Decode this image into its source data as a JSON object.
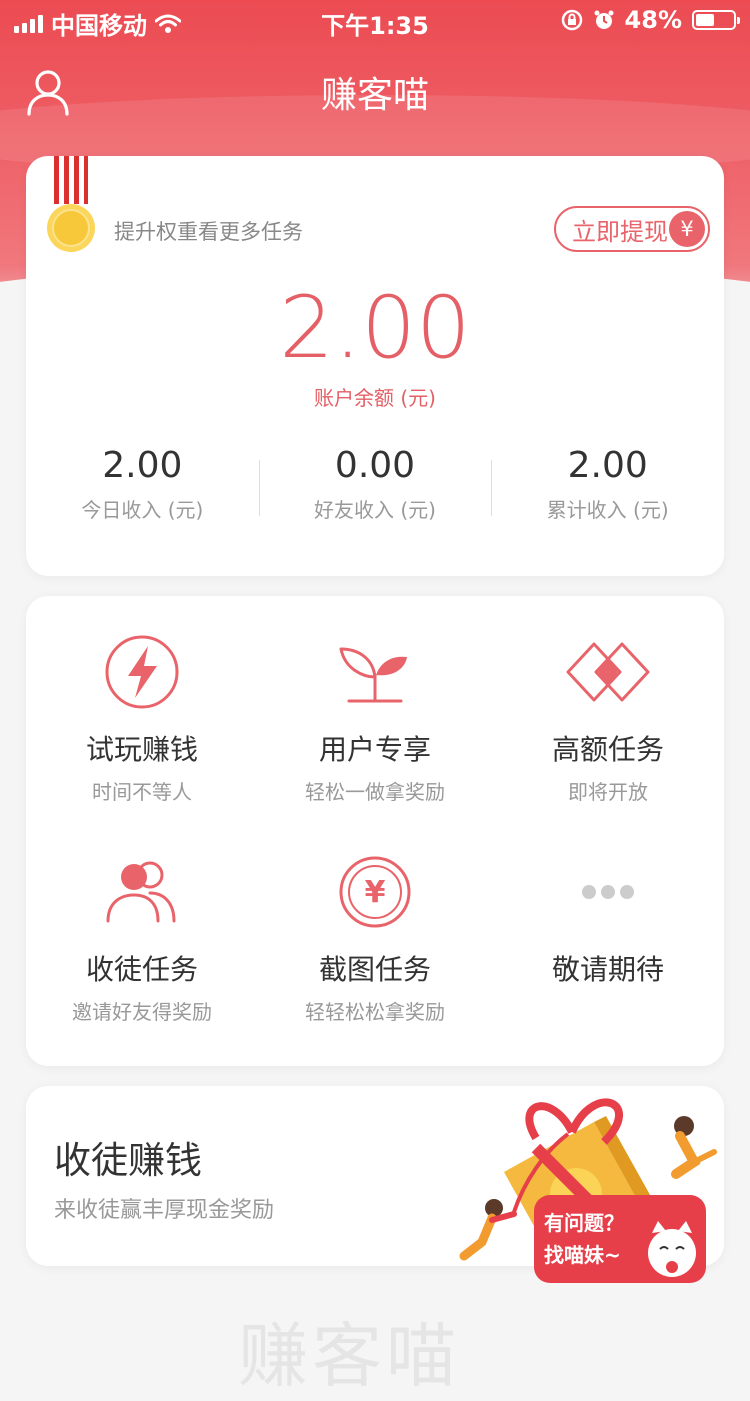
{
  "status_bar": {
    "carrier": "中国移动",
    "time": "下午1:35",
    "battery": "48%"
  },
  "nav": {
    "title": "赚客喵"
  },
  "account": {
    "upgrade_hint": "提升权重看更多任务",
    "withdraw_label": "立即提现",
    "withdraw_icon": "¥",
    "balance": "2.00",
    "balance_label": "账户余额 (元)",
    "stats": [
      {
        "value": "2.00",
        "label": "今日收入 (元)"
      },
      {
        "value": "0.00",
        "label": "好友收入 (元)"
      },
      {
        "value": "2.00",
        "label": "累计收入 (元)"
      }
    ]
  },
  "tasks": [
    {
      "title": "试玩赚钱",
      "subtitle": "时间不等人",
      "icon": "lightning-icon"
    },
    {
      "title": "用户专享",
      "subtitle": "轻松一做拿奖励",
      "icon": "sprout-icon"
    },
    {
      "title": "高额任务",
      "subtitle": "即将开放",
      "icon": "diamond-icon"
    },
    {
      "title": "收徒任务",
      "subtitle": "邀请好友得奖励",
      "icon": "users-icon"
    },
    {
      "title": "截图任务",
      "subtitle": "轻轻松松拿奖励",
      "icon": "yen-coin-icon"
    },
    {
      "title": "敬请期待",
      "subtitle": "",
      "icon": "more-dots-icon"
    }
  ],
  "invite": {
    "title": "收徒赚钱",
    "subtitle": "来收徒赢丰厚现金奖励"
  },
  "help": {
    "line1": "有问题？",
    "line2": "找喵妹~"
  },
  "footer_text": "赚客喵",
  "colors": {
    "primary": "#e8646a",
    "header": "#ec4b52"
  }
}
